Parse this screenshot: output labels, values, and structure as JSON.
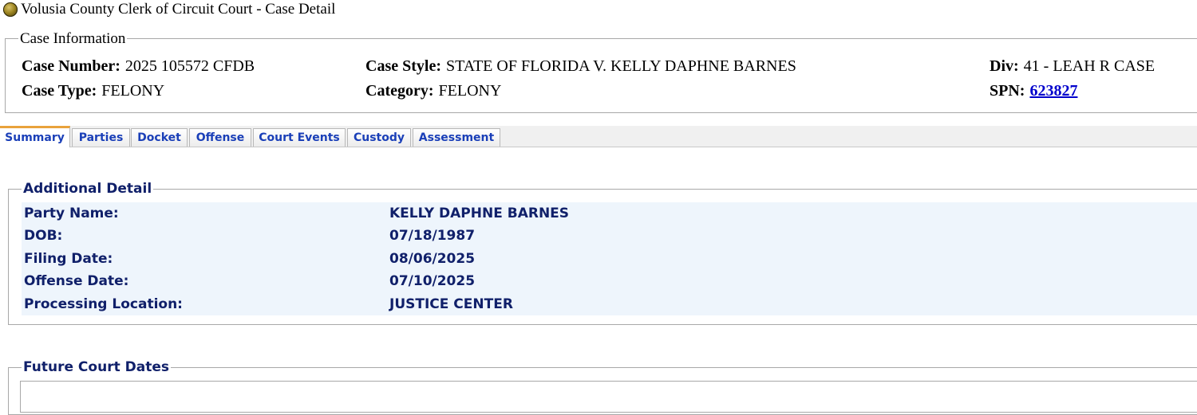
{
  "page": {
    "title": "Volusia County Clerk of Circuit Court - Case Detail",
    "title_icon": "gold-orb-icon"
  },
  "case_info": {
    "legend": "Case Information",
    "case_number_label": "Case Number:",
    "case_number": "2025 105572 CFDB",
    "case_style_label": "Case Style:",
    "case_style": "STATE OF FLORIDA V. KELLY DAPHNE BARNES",
    "div_label": "Div:",
    "div": "41 - LEAH R CASE",
    "case_type_label": "Case Type:",
    "case_type": "FELONY",
    "category_label": "Category:",
    "category": "FELONY",
    "spn_label": "SPN:",
    "spn": "623827"
  },
  "tabs": [
    {
      "label": "Summary",
      "active": true
    },
    {
      "label": "Parties",
      "active": false
    },
    {
      "label": "Docket",
      "active": false
    },
    {
      "label": "Offense",
      "active": false
    },
    {
      "label": "Court Events",
      "active": false
    },
    {
      "label": "Custody",
      "active": false
    },
    {
      "label": "Assessment",
      "active": false
    }
  ],
  "additional_detail": {
    "legend": "Additional Detail",
    "rows": [
      {
        "label": "Party Name:",
        "value": "KELLY DAPHNE BARNES"
      },
      {
        "label": "DOB:",
        "value": "07/18/1987"
      },
      {
        "label": "Filing Date:",
        "value": "08/06/2025"
      },
      {
        "label": "Offense Date:",
        "value": "07/10/2025"
      },
      {
        "label": "Processing Location:",
        "value": "JUSTICE CENTER"
      }
    ]
  },
  "future_court_dates": {
    "legend": "Future Court Dates"
  },
  "colors": {
    "tab_text": "#1a3fb8",
    "active_tab_accent": "#e9a23b",
    "detail_text": "#10206a",
    "detail_bg": "#eef5fc",
    "link": "#0000cc"
  }
}
